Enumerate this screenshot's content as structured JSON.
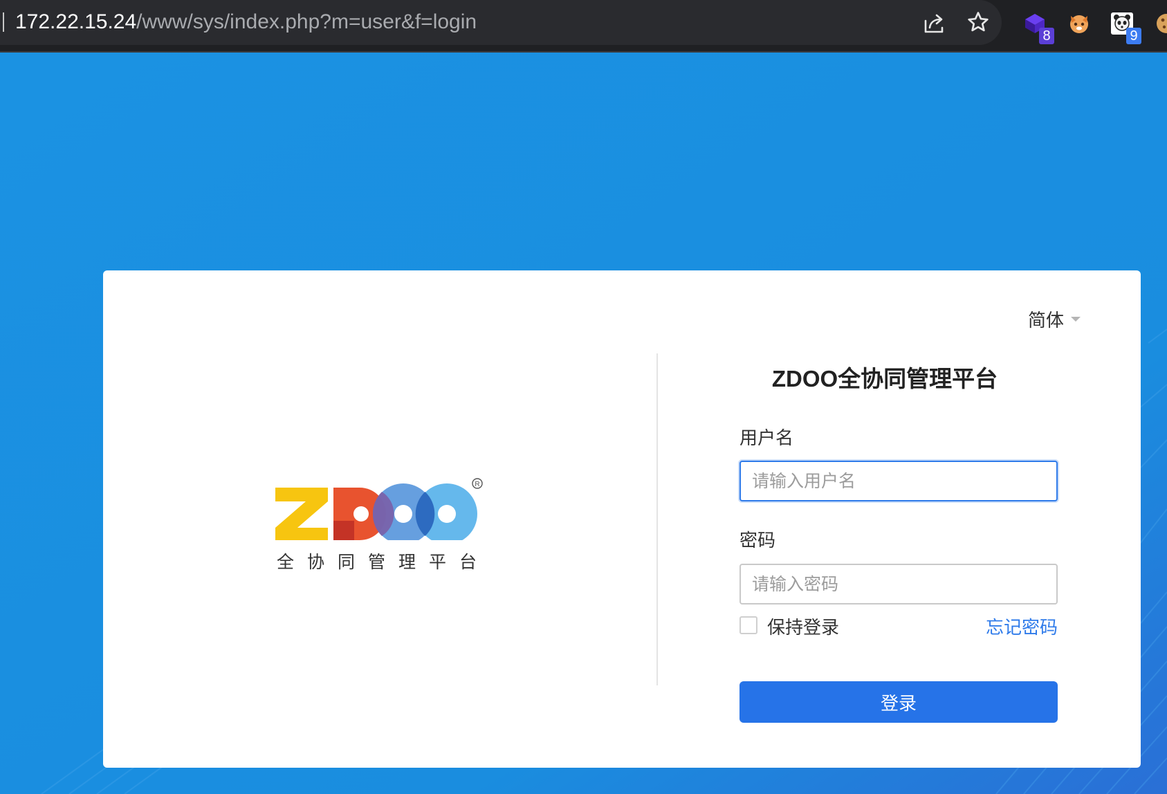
{
  "browser": {
    "url_host": "172.22.15.24",
    "url_path": "/www/sys/index.php?m=user&f=login",
    "extensions": [
      {
        "icon": "purple-cube-extension-icon",
        "badge": "8",
        "badge_color": "#5b3fd6"
      },
      {
        "icon": "orange-fox-extension-icon"
      },
      {
        "icon": "panda-extension-icon",
        "badge": "9",
        "badge_color": "#3c7cf2"
      },
      {
        "icon": "cookie-extension-icon"
      }
    ]
  },
  "theme": {
    "page_background": "#1a8fe0",
    "accent": "#2673e8",
    "link_color": "#2f7bea"
  },
  "login": {
    "language": "简体",
    "logo_text": "ZDOO",
    "logo_subtitle": "全协同管理平台",
    "title": "ZDOO全协同管理平台",
    "username_label": "用户名",
    "username_placeholder": "请输入用户名",
    "username_value": "",
    "password_label": "密码",
    "password_placeholder": "请输入密码",
    "password_value": "",
    "remember_label": "保持登录",
    "remember_checked": false,
    "forgot_label": "忘记密码",
    "submit_label": "登录"
  }
}
